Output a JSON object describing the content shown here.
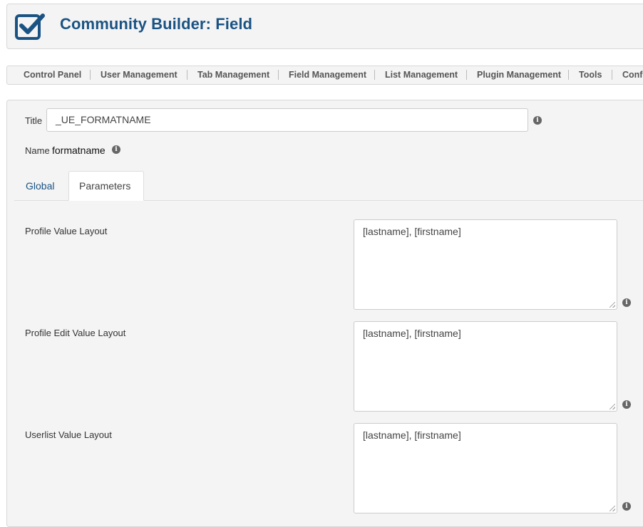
{
  "header": {
    "title": "Community Builder: Field",
    "logo_icon": "checkbox-checked-icon",
    "accent_color": "#1a5383"
  },
  "nav": {
    "items": [
      "Control Panel",
      "User Management",
      "Tab Management",
      "Field Management",
      "List Management",
      "Plugin Management",
      "Tools",
      "Confi"
    ]
  },
  "form": {
    "title_label": "Title",
    "title_value": "_UE_FORMATNAME",
    "name_label": "Name",
    "name_value": "formatname",
    "info_icon": "info-icon"
  },
  "tabs": {
    "global": "Global",
    "parameters": "Parameters",
    "active": "Parameters"
  },
  "parameters": [
    {
      "label": "Profile Value Layout",
      "value": "[lastname], [firstname]"
    },
    {
      "label": "Profile Edit Value Layout",
      "value": "[lastname], [firstname]"
    },
    {
      "label": "Userlist Value Layout",
      "value": "[lastname], [firstname]"
    }
  ]
}
